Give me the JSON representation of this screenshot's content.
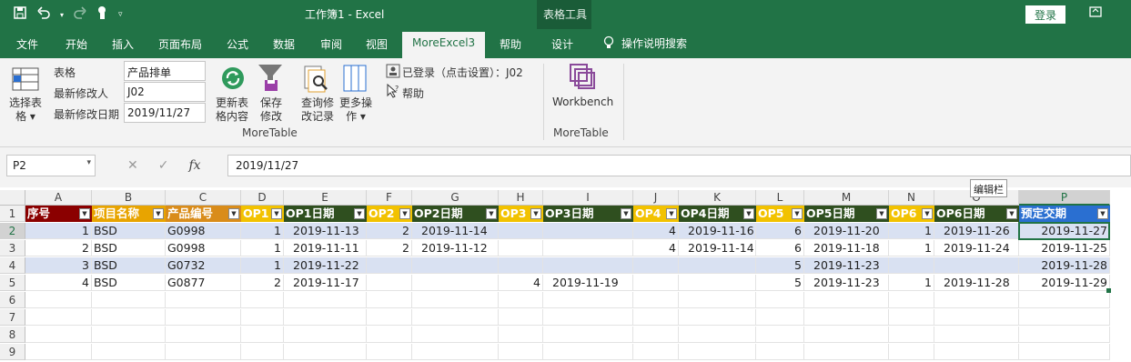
{
  "title_bar": {
    "doc_title": "工作簿1  -  Excel",
    "contextual_tools_title": "表格工具",
    "login_label": "登录"
  },
  "tabs": [
    "文件",
    "开始",
    "插入",
    "页面布局",
    "公式",
    "数据",
    "审阅",
    "视图",
    "MoreExcel3",
    "帮助",
    "设计"
  ],
  "active_tab": "MoreExcel3",
  "tell_me": "操作说明搜索",
  "ribbon": {
    "select_table_label_1": "选择表",
    "select_table_label_2": "格 ▾",
    "table_label": "表格",
    "table_value": "产品排单",
    "modifier_label": "最新修改人",
    "modifier_value": "J02",
    "modified_date_label": "最新修改日期",
    "modified_date_value": "2019/11/27",
    "refresh_label_1": "更新表",
    "refresh_label_2": "格内容",
    "save_label_1": "保存",
    "save_label_2": "修改",
    "history_label_1": "查询修",
    "history_label_2": "改记录",
    "more_label_1": "更多操",
    "more_label_2": "作 ▾",
    "login_status": "已登录（点击设置）：J02",
    "help_label": "帮助",
    "group1_label": "MoreTable",
    "workbench_label": "Workbench",
    "group2_label": "MoreTable"
  },
  "formula_bar": {
    "name_box": "P2",
    "formula": "2019/11/27",
    "tooltip": "编辑栏"
  },
  "columns": [
    "A",
    "B",
    "C",
    "D",
    "E",
    "F",
    "G",
    "H",
    "I",
    "J",
    "K",
    "L",
    "M",
    "N",
    "O",
    "P"
  ],
  "row_numbers": [
    "1",
    "2",
    "3",
    "4",
    "5",
    "6",
    "7",
    "8",
    "9"
  ],
  "header_row": [
    "序号",
    "项目名称",
    "产品编号",
    "OP1",
    "OP1日期",
    "OP2",
    "OP2日期",
    "OP3",
    "OP3日期",
    "OP4",
    "OP4日期",
    "OP5",
    "OP5日期",
    "OP6",
    "OP6日期",
    "预定交期"
  ],
  "header_colors": [
    "#8b0000",
    "#e8a400",
    "#d98c1a",
    "#f2c200",
    "#2f4f1f",
    "#f2c200",
    "#2f4f1f",
    "#f2c200",
    "#2f4f1f",
    "#f2c200",
    "#2f4f1f",
    "#f2c200",
    "#2f4f1f",
    "#f2c200",
    "#2f4f1f",
    "#2a6fd1"
  ],
  "rows": [
    [
      "1",
      "BSD",
      "G0998",
      "1",
      "2019-11-13",
      "2",
      "2019-11-14",
      "",
      "",
      "4",
      "2019-11-16",
      "6",
      "2019-11-20",
      "1",
      "2019-11-26",
      "2019-11-27"
    ],
    [
      "2",
      "BSD",
      "G0998",
      "1",
      "2019-11-11",
      "2",
      "2019-11-12",
      "",
      "",
      "4",
      "2019-11-14",
      "6",
      "2019-11-18",
      "1",
      "2019-11-24",
      "2019-11-25"
    ],
    [
      "3",
      "BSD",
      "G0732",
      "1",
      "2019-11-22",
      "",
      "",
      "",
      "",
      "",
      "",
      "5",
      "2019-11-23",
      "",
      "",
      "2019-11-28"
    ],
    [
      "4",
      "BSD",
      "G0877",
      "2",
      "2019-11-17",
      "",
      "",
      "4",
      "2019-11-19",
      "",
      "",
      "5",
      "2019-11-23",
      "1",
      "2019-11-28",
      "2019-11-29"
    ]
  ],
  "colors": {
    "accent": "#217346",
    "band_row": "#d9e1f2",
    "selected_cell": "#217346"
  }
}
